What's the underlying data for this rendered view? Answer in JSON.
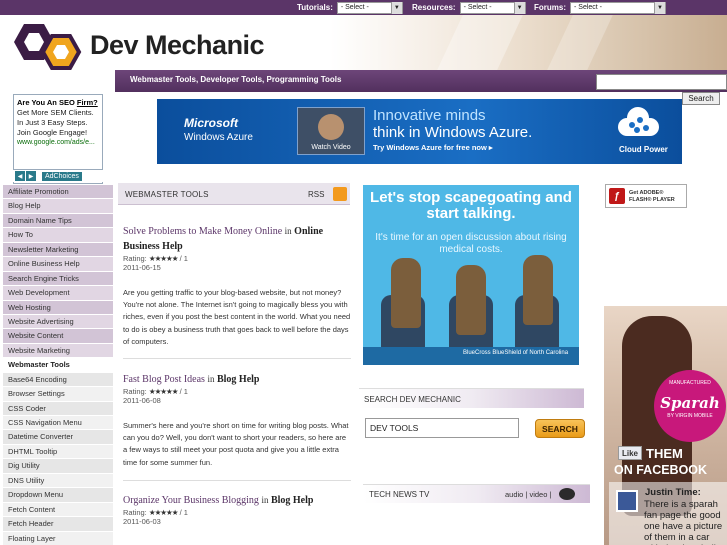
{
  "topbar": {
    "tutorials_label": "Tutorials:",
    "resources_label": "Resources:",
    "forums_label": "Forums:",
    "select_value": "- Select -"
  },
  "header": {
    "logo_text": "Dev Mechanic"
  },
  "nav": {
    "tagline": "Webmaster Tools, Developer Tools, Programming Tools",
    "search_button": "Search"
  },
  "left_ad": {
    "headline_a": "Are You An SEO",
    "headline_b": "Firm?",
    "body": "Get More SEM Clients. In Just 3 Easy Steps. Join Google Engage!",
    "url": "www.google.com/ads/e...",
    "adchoices": "AdChoices"
  },
  "categories": [
    "Affiliate Promotion",
    "Blog Help",
    "Domain Name Tips",
    "How To",
    "Newsletter Marketing",
    "Online Business Help",
    "Search Engine Tricks",
    "Web Development",
    "Web Hosting",
    "Website Advertising",
    "Website Content",
    "Website Marketing"
  ],
  "tools_heading": "Webmaster Tools",
  "tools": [
    "Base64 Encoding",
    "Browser Settings",
    "CSS Coder",
    "CSS Navigation Menu",
    "Datetime Converter",
    "DHTML Tooltip",
    "Dig Utility",
    "DNS Utility",
    "Dropdown Menu",
    "Fetch Content",
    "Fetch Header",
    "Floating Layer"
  ],
  "banner": {
    "brand": "Microsoft",
    "product": "Windows Azure",
    "video_caption": "Watch Video",
    "headline_1": "Innovative minds",
    "headline_2": "think in Windows Azure.",
    "cta": "Try Windows Azure for free now ▸",
    "tag": "Cloud Power"
  },
  "section": {
    "title": "WEBMASTER TOOLS",
    "rss": "RSS"
  },
  "posts": [
    {
      "title": "Solve Problems to Make Money Online",
      "in": "in",
      "category": "Online Business Help",
      "rating_label": "Rating:",
      "stars": "★★★★★",
      "rating_value": "/ 1",
      "date": "2011-06-15",
      "excerpt": "Are you getting traffic to your blog-based website, but not money? You're not alone. The Internet isn't going to magically bless you with riches, even if you post the best content in the world. What you need to do is obey a business truth that goes back to well before the days of computers."
    },
    {
      "title": "Fast Blog Post Ideas",
      "in": "in",
      "category": "Blog Help",
      "rating_label": "Rating:",
      "stars": "★★★★★",
      "rating_value": "/ 1",
      "date": "2011-06-08",
      "excerpt": "Summer's here and you're short on time for writing blog posts. What can you do? Well, you don't want to short your readers, so here are a few ways to still meet your post quota and give you a little extra time for some summer fun."
    },
    {
      "title": "Organize Your Business Blogging",
      "in": "in",
      "category": "Blog Help",
      "rating_label": "Rating:",
      "stars": "★★★★★",
      "rating_value": "/ 1",
      "date": "2011-06-03"
    }
  ],
  "bcbs_ad": {
    "line1": "Let's stop scapegoating and start talking.",
    "line2": "It's time for an open discussion about rising medical costs.",
    "footer": "BlueCross BlueShield of North Carolina"
  },
  "search_dm": {
    "title": "SEARCH DEV MECHANIC",
    "input_value": "DEV TOOLS",
    "button": "SEARCH"
  },
  "tech_news": {
    "title": "TECH NEWS TV",
    "links": "audio | video |"
  },
  "flash_badge": {
    "text_1": "Get ADOBE®",
    "text_2": "FLASH® PLAYER"
  },
  "sparah_ad": {
    "brand": "Sparah",
    "arc_text": "MANUFACTURED",
    "sub": "BY VIRGIN MOBILE",
    "like": "Like",
    "them": "THEM",
    "on_facebook": "ON FACEBOOK",
    "author": "Justin Time:",
    "message": "There is a sparah fan page the good one have a picture of them in a car with the door hall"
  }
}
